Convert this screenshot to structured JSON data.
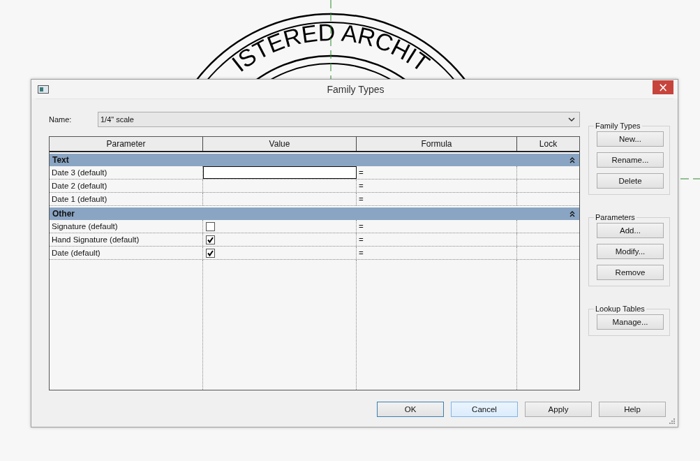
{
  "canvas": {
    "stamp_text": "ISTERED ARCHIT"
  },
  "window": {
    "title": "Family Types",
    "close": "×"
  },
  "name_field": {
    "label": "Name:",
    "value": "1/4\" scale"
  },
  "table": {
    "columns": [
      "Parameter",
      "Value",
      "Formula",
      "Lock"
    ],
    "groups": [
      {
        "title": "Text",
        "expanded": true,
        "rows": [
          {
            "name": "Date 3 (default)",
            "kind": "text",
            "selected": true,
            "formula": "="
          },
          {
            "name": "Date 2 (default)",
            "kind": "text",
            "selected": false,
            "formula": "="
          },
          {
            "name": "Date 1 (default)",
            "kind": "text",
            "selected": false,
            "formula": "="
          }
        ]
      },
      {
        "title": "Other",
        "expanded": true,
        "rows": [
          {
            "name": "Signature (default)",
            "kind": "checkbox",
            "checked": false,
            "selected": false,
            "formula": "="
          },
          {
            "name": "Hand Signature (default)",
            "kind": "checkbox",
            "checked": true,
            "selected": false,
            "formula": "="
          },
          {
            "name": "Date (default)",
            "kind": "checkbox",
            "checked": true,
            "selected": false,
            "formula": "="
          }
        ]
      }
    ]
  },
  "side_groups": [
    {
      "title": "Family Types",
      "buttons": [
        "New...",
        "Rename...",
        "Delete"
      ]
    },
    {
      "title": "Parameters",
      "buttons": [
        "Add...",
        "Modify...",
        "Remove"
      ]
    },
    {
      "title": "Lookup Tables",
      "buttons": [
        "Manage..."
      ]
    }
  ],
  "footer_buttons": [
    {
      "label": "OK",
      "focused": true,
      "hovered": false
    },
    {
      "label": "Cancel",
      "focused": false,
      "hovered": true
    },
    {
      "label": "Apply",
      "focused": false,
      "hovered": false
    },
    {
      "label": "Help",
      "focused": false,
      "hovered": false
    }
  ]
}
